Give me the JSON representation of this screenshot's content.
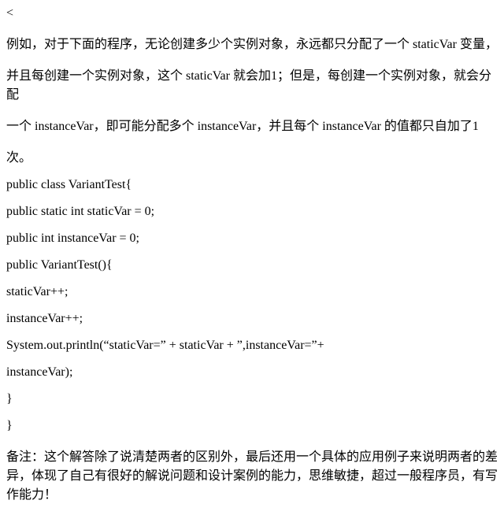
{
  "intro": {
    "line1": "例如，对于下面的程序，无论创建多少个实例对象，永远都只分配了一个 staticVar 变量，",
    "line2": "并且每创建一个实例对象，这个 staticVar 就会加1；但是，每创建一个实例对象，就会分配",
    "line3": "一个 instanceVar，即可能分配多个 instanceVar，并且每个 instanceVar 的值都只自加了1",
    "line4": "次。"
  },
  "code": {
    "l1": "public class VariantTest{",
    "l2": "            public static int staticVar = 0;",
    "l3": "            public int instanceVar = 0;",
    "l4": "            public VariantTest(){",
    "l5": "                        staticVar++;",
    "l6": "                        instanceVar++;",
    "l7": "                        System.out.println(“staticVar=” + staticVar + ”,instanceVar=”+",
    "l8": "instanceVar);",
    "l9": "            }",
    "l10": "}"
  },
  "note": "备注：这个解答除了说清楚两者的区别外，最后还用一个具体的应用例子来说明两者的差异，体现了自己有很好的解说问题和设计案例的能力，思维敏捷，超过一般程序员，有写作能力！"
}
